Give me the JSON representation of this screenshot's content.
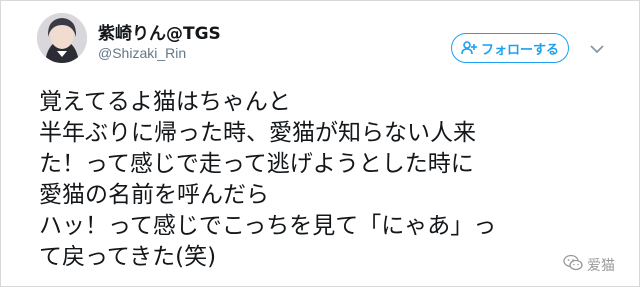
{
  "author": {
    "name": "紫崎りん@TGS",
    "handle": "@Shizaki_Rin"
  },
  "actions": {
    "follow_label": "フォローする",
    "follow_icon": "add-person-icon",
    "menu_icon": "chevron-down-icon"
  },
  "tweet": {
    "lines": [
      "覚えてるよ猫はちゃんと",
      "半年ぶりに帰った時、愛猫が知らない人来",
      "た！って感じで走って逃げようとした時に",
      "愛猫の名前を呼んだら",
      "ハッ！って感じでこっちを見て「にゃあ」っ",
      "て戻ってきた(笑)"
    ]
  },
  "watermark": {
    "label": "爱猫",
    "icon": "wechat-icon"
  },
  "colors": {
    "accent": "#1da1f2",
    "text": "#14171a",
    "secondary": "#657786"
  }
}
